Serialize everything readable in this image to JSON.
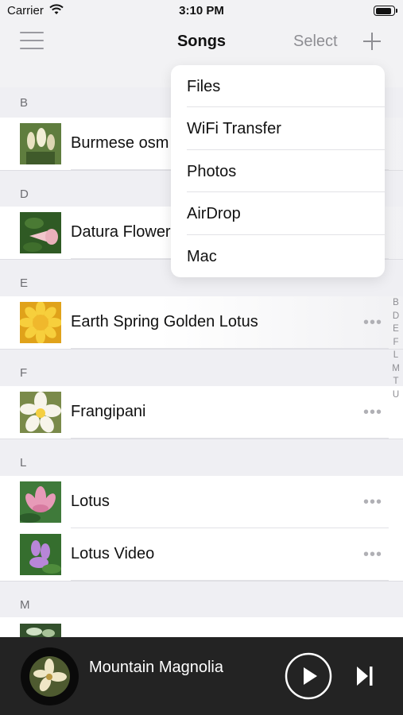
{
  "status_bar": {
    "carrier": "Carrier",
    "time": "3:10 PM",
    "battery_level": 0.95
  },
  "nav": {
    "title": "Songs",
    "select_label": "Select",
    "menu_icon": "hamburger-icon",
    "add_icon": "plus-icon"
  },
  "sections": [
    {
      "header": "B",
      "items": [
        {
          "title": "Burmese osm"
        }
      ]
    },
    {
      "header": "D",
      "items": [
        {
          "title": "Datura Flower"
        }
      ]
    },
    {
      "header": "E",
      "items": [
        {
          "title": "Earth Spring Golden Lotus",
          "more": "•••"
        }
      ]
    },
    {
      "header": "F",
      "items": [
        {
          "title": "Frangipani",
          "more": "•••"
        }
      ]
    },
    {
      "header": "L",
      "items": [
        {
          "title": "Lotus",
          "more": "•••"
        },
        {
          "title": "Lotus Video",
          "more": "•••"
        }
      ]
    },
    {
      "header": "M",
      "items": []
    }
  ],
  "index_letters": [
    "B",
    "D",
    "E",
    "F",
    "L",
    "M",
    "T",
    "U"
  ],
  "add_menu": {
    "items": [
      "Files",
      "WiFi Transfer",
      "Photos",
      "AirDrop",
      "Mac"
    ]
  },
  "player": {
    "title": "Mountain Magnolia",
    "play_icon": "play-icon",
    "next_icon": "skip-next-icon"
  },
  "colors": {
    "header_bg": "#f2f2f4",
    "player_bg": "#232323",
    "secondary_text": "#8e8e93"
  }
}
